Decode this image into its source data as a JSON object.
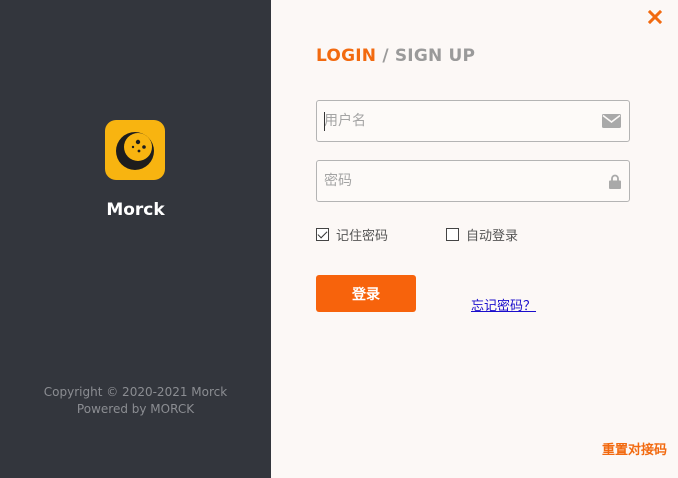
{
  "brand": {
    "app_name": "Morck",
    "copyright": "Copyright © 2020-2021 Morck",
    "powered_by": "Powered by MORCK"
  },
  "header": {
    "login_tab": "LOGIN",
    "separator": "/",
    "signup_tab": "SIGN UP",
    "close_icon": "close-icon"
  },
  "form": {
    "username_placeholder": "用户名",
    "username_value": "",
    "username_icon": "envelope-icon",
    "password_placeholder": "密码",
    "password_value": "",
    "password_icon": "lock-icon",
    "remember_label": "记住密码",
    "remember_checked": true,
    "autologin_label": "自动登录",
    "autologin_checked": false,
    "login_button": "登录",
    "forgot_link": "忘记密码？",
    "reset_link": "重置对接码"
  },
  "colors": {
    "accent": "#f26a10",
    "sidebar_bg": "#33363d",
    "logo_bg": "#f8b410",
    "link": "#1a0dcc"
  }
}
